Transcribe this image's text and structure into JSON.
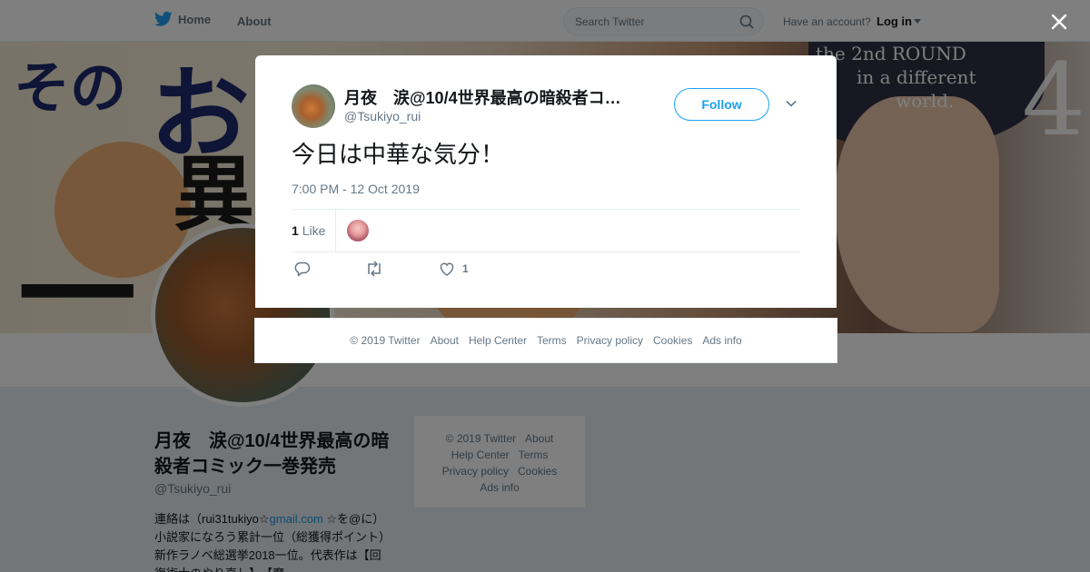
{
  "topbar": {
    "home_label": "Home",
    "about_label": "About",
    "search_placeholder": "Search Twitter",
    "have_account": "Have an account?",
    "login_label": "Log in"
  },
  "banner": {
    "kana_1": "その",
    "kana_2": "お",
    "kana_3": "異",
    "kana_4": "一",
    "eng_line_1": "the 2nd ROUND",
    "eng_line_2": "in a different",
    "eng_line_3": "world.",
    "number": "4"
  },
  "profile": {
    "name": "月夜　涙@10/4世界最高の暗殺者コミック一巻発売",
    "handle": "@Tsukiyo_rui",
    "bio_before_link": "連絡は（rui31tukiyo☆",
    "bio_link": "gmail.com",
    "bio_after_link": " ☆を@に）小説家になろう累計一位（総獲得ポイント）　新作ラノベ総選挙2018一位。代表作は【回復術士のやり直し】、【魔"
  },
  "side_footer": {
    "links": [
      "© 2019 Twitter",
      "About",
      "Help Center",
      "Terms",
      "Privacy policy",
      "Cookies",
      "Ads info"
    ]
  },
  "tweet": {
    "author_name": "月夜　涙@10/4世界最高の暗殺者コ…",
    "author_handle": "@Tsukiyo_rui",
    "follow_label": "Follow",
    "text": "今日は中華な気分！",
    "timestamp": "7:00 PM - 12 Oct 2019",
    "like_count": "1",
    "like_label": "Like",
    "action_like_count": "1"
  },
  "modal_footer": {
    "links": [
      "© 2019 Twitter",
      "About",
      "Help Center",
      "Terms",
      "Privacy policy",
      "Cookies",
      "Ads info"
    ]
  },
  "colors": {
    "brand_blue": "#1da1f2",
    "muted_text": "#657786",
    "overlay": "rgba(0,0,0,0.5)"
  },
  "icons": [
    "twitter-bird-icon",
    "search-icon",
    "caret-down-icon",
    "close-icon",
    "chevron-down-icon",
    "reply-icon",
    "retweet-icon",
    "heart-icon"
  ]
}
